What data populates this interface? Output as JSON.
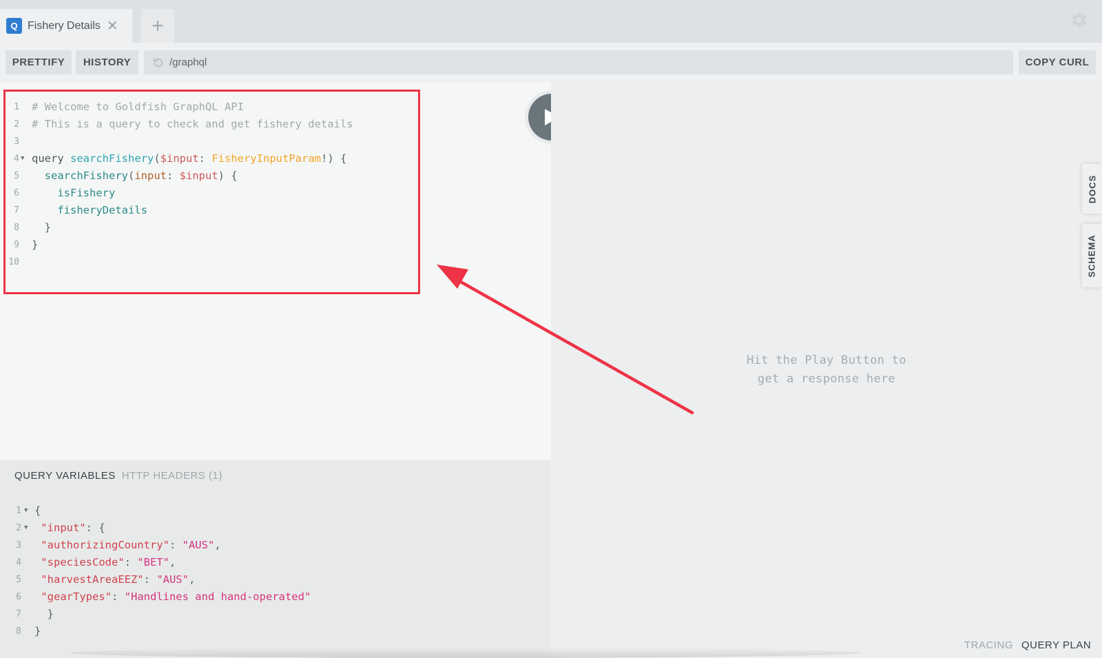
{
  "tabs": {
    "active": {
      "icon_letter": "Q",
      "title": "Fishery Details",
      "close": "✕"
    },
    "add_label": "+"
  },
  "toolbar": {
    "prettify": "PRETTIFY",
    "history": "HISTORY",
    "url": "/graphql",
    "copy_curl": "COPY CURL"
  },
  "editor": {
    "lines": [
      {
        "n": "1",
        "fold": "",
        "tokens": [
          {
            "t": "# Welcome to Goldfish GraphQL API",
            "c": "comment"
          }
        ]
      },
      {
        "n": "2",
        "fold": "",
        "tokens": [
          {
            "t": "# This is a query to check and get fishery details",
            "c": "comment"
          }
        ]
      },
      {
        "n": "3",
        "fold": "",
        "tokens": []
      },
      {
        "n": "4",
        "fold": "▼",
        "tokens": [
          {
            "t": "query ",
            "c": "kw"
          },
          {
            "t": "searchFishery",
            "c": "def"
          },
          {
            "t": "(",
            "c": "punc"
          },
          {
            "t": "$input",
            "c": "var"
          },
          {
            "t": ": ",
            "c": "punc"
          },
          {
            "t": "FisheryInputParam",
            "c": "type"
          },
          {
            "t": "!) {",
            "c": "punc"
          }
        ]
      },
      {
        "n": "5",
        "fold": "",
        "tokens": [
          {
            "t": "  searchFishery",
            "c": "field"
          },
          {
            "t": "(",
            "c": "punc"
          },
          {
            "t": "input",
            "c": "arg"
          },
          {
            "t": ": ",
            "c": "punc"
          },
          {
            "t": "$input",
            "c": "var"
          },
          {
            "t": ") {",
            "c": "punc"
          }
        ]
      },
      {
        "n": "6",
        "fold": "",
        "tokens": [
          {
            "t": "    isFishery",
            "c": "field"
          }
        ]
      },
      {
        "n": "7",
        "fold": "",
        "tokens": [
          {
            "t": "    fisheryDetails",
            "c": "field"
          }
        ]
      },
      {
        "n": "8",
        "fold": "",
        "tokens": [
          {
            "t": "  }",
            "c": "punc"
          }
        ]
      },
      {
        "n": "9",
        "fold": "",
        "tokens": [
          {
            "t": "}",
            "c": "punc"
          }
        ]
      },
      {
        "n": "10",
        "fold": "",
        "tokens": []
      }
    ]
  },
  "variables": {
    "tab_active": "QUERY VARIABLES",
    "tab_inactive": "HTTP HEADERS (1)",
    "lines": [
      {
        "n": "1",
        "fold": "▼",
        "tokens": [
          {
            "t": "{",
            "c": "punc"
          }
        ]
      },
      {
        "n": "2",
        "fold": "▼",
        "tokens": [
          {
            "t": " \"input\"",
            "c": "key"
          },
          {
            "t": ": {",
            "c": "punc"
          }
        ]
      },
      {
        "n": "3",
        "fold": "",
        "tokens": [
          {
            "t": " \"authorizingCountry\"",
            "c": "key"
          },
          {
            "t": ": ",
            "c": "punc"
          },
          {
            "t": "\"AUS\"",
            "c": "str"
          },
          {
            "t": ",",
            "c": "punc"
          }
        ]
      },
      {
        "n": "4",
        "fold": "",
        "tokens": [
          {
            "t": " \"speciesCode\"",
            "c": "key"
          },
          {
            "t": ": ",
            "c": "punc"
          },
          {
            "t": "\"BET\"",
            "c": "str"
          },
          {
            "t": ",",
            "c": "punc"
          }
        ]
      },
      {
        "n": "5",
        "fold": "",
        "tokens": [
          {
            "t": " \"harvestAreaEEZ\"",
            "c": "key"
          },
          {
            "t": ": ",
            "c": "punc"
          },
          {
            "t": "\"AUS\"",
            "c": "str"
          },
          {
            "t": ",",
            "c": "punc"
          }
        ]
      },
      {
        "n": "6",
        "fold": "",
        "tokens": [
          {
            "t": " \"gearTypes\"",
            "c": "key"
          },
          {
            "t": ": ",
            "c": "punc"
          },
          {
            "t": "\"Handlines and hand-operated\"",
            "c": "str"
          }
        ]
      },
      {
        "n": "7",
        "fold": "",
        "tokens": [
          {
            "t": "  }",
            "c": "punc"
          }
        ]
      },
      {
        "n": "8",
        "fold": "",
        "tokens": [
          {
            "t": "}",
            "c": "punc"
          }
        ]
      }
    ]
  },
  "response": {
    "hint_line1": "Hit the Play Button to",
    "hint_line2": "get a response here"
  },
  "side_tabs": {
    "docs": "DOCS",
    "schema": "SCHEMA"
  },
  "footer": {
    "tracing": "TRACING",
    "query_plan": "QUERY PLAN"
  },
  "colors": {
    "annotation_red": "#ee3346",
    "accent_blue": "#2e7dd1"
  },
  "icons": {
    "settings": "gear-icon",
    "reload": "reload-icon",
    "play": "play-icon",
    "annotation": "red-arrow"
  }
}
